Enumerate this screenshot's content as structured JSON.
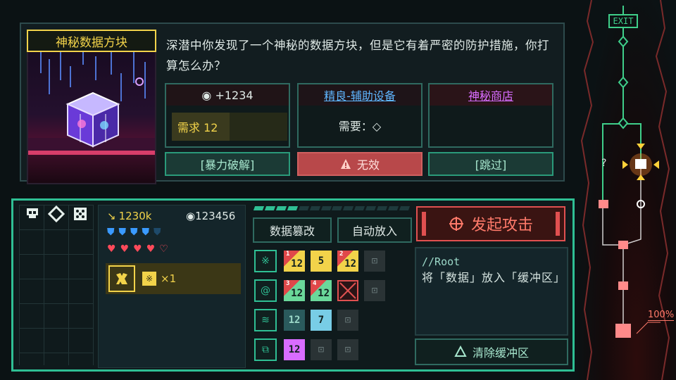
{
  "event": {
    "title": "神秘数据方块",
    "description": "深潜中你发现了一个神秘的数据方块，但是它有着严密的防护措施，你打算怎么办？",
    "options": [
      {
        "header": "◉ +1234",
        "requirement_label": "需求 12",
        "requirement_value": 12,
        "action": "[暴力破解]"
      },
      {
        "header": "精良-辅助设备",
        "requirement_label": "需要：◇",
        "action": "无效"
      },
      {
        "header": "神秘商店",
        "action": "[跳过]"
      }
    ]
  },
  "player": {
    "attack_power": "1230k",
    "credits": "◉123456",
    "shields_full": 4,
    "shields_total": 5,
    "hearts_full": 4,
    "hearts_total": 5,
    "item_multiplier": "×1"
  },
  "progress": {
    "filled": 4,
    "total": 14
  },
  "commands": {
    "tamper": "数据篡改",
    "auto_insert": "自动放入"
  },
  "buffer_rows": [
    {
      "icon": "※",
      "cells": [
        {
          "type": "split",
          "top": "1",
          "value": "12",
          "color1": "#f2d34a",
          "color2": "#e0484a"
        },
        {
          "type": "value",
          "value": "5",
          "color": "#f2d34a"
        },
        {
          "type": "split",
          "top": "2",
          "value": "12",
          "color1": "#f2d34a",
          "color2": "#e0484a"
        },
        {
          "type": "lock"
        }
      ]
    },
    {
      "icon": "@",
      "cells": [
        {
          "type": "split",
          "top": "3",
          "value": "12",
          "color1": "#6ad89a",
          "color2": "#e0484a"
        },
        {
          "type": "split",
          "top": "4",
          "value": "12",
          "color1": "#6ad89a",
          "color2": "#e0484a"
        },
        {
          "type": "blocked"
        },
        {
          "type": "lock"
        }
      ]
    },
    {
      "icon": "≋",
      "cells": [
        {
          "type": "value",
          "value": "12",
          "color": "#2a5a5c",
          "text": "#9bd8c8"
        },
        {
          "type": "value",
          "value": "7",
          "color": "#78cde6"
        },
        {
          "type": "lock"
        }
      ]
    },
    {
      "icon": "⧉",
      "cells": [
        {
          "type": "value",
          "value": "12",
          "color": "#d86cff"
        },
        {
          "type": "lock"
        },
        {
          "type": "lock"
        }
      ]
    }
  ],
  "attack": {
    "label": "发起攻击"
  },
  "console": {
    "title": "//Root",
    "text": "将「数据」放入「缓冲区」"
  },
  "clear_buffer": {
    "label": "清除缓冲区"
  },
  "map": {
    "exit_label": "EXIT",
    "unknown_label": "?",
    "percent_label": "100%"
  },
  "colors": {
    "accent": "#2fbf94",
    "warning": "#e05050",
    "gold": "#f2d34a",
    "blue": "#5fb6ff",
    "purple": "#d86cff"
  }
}
